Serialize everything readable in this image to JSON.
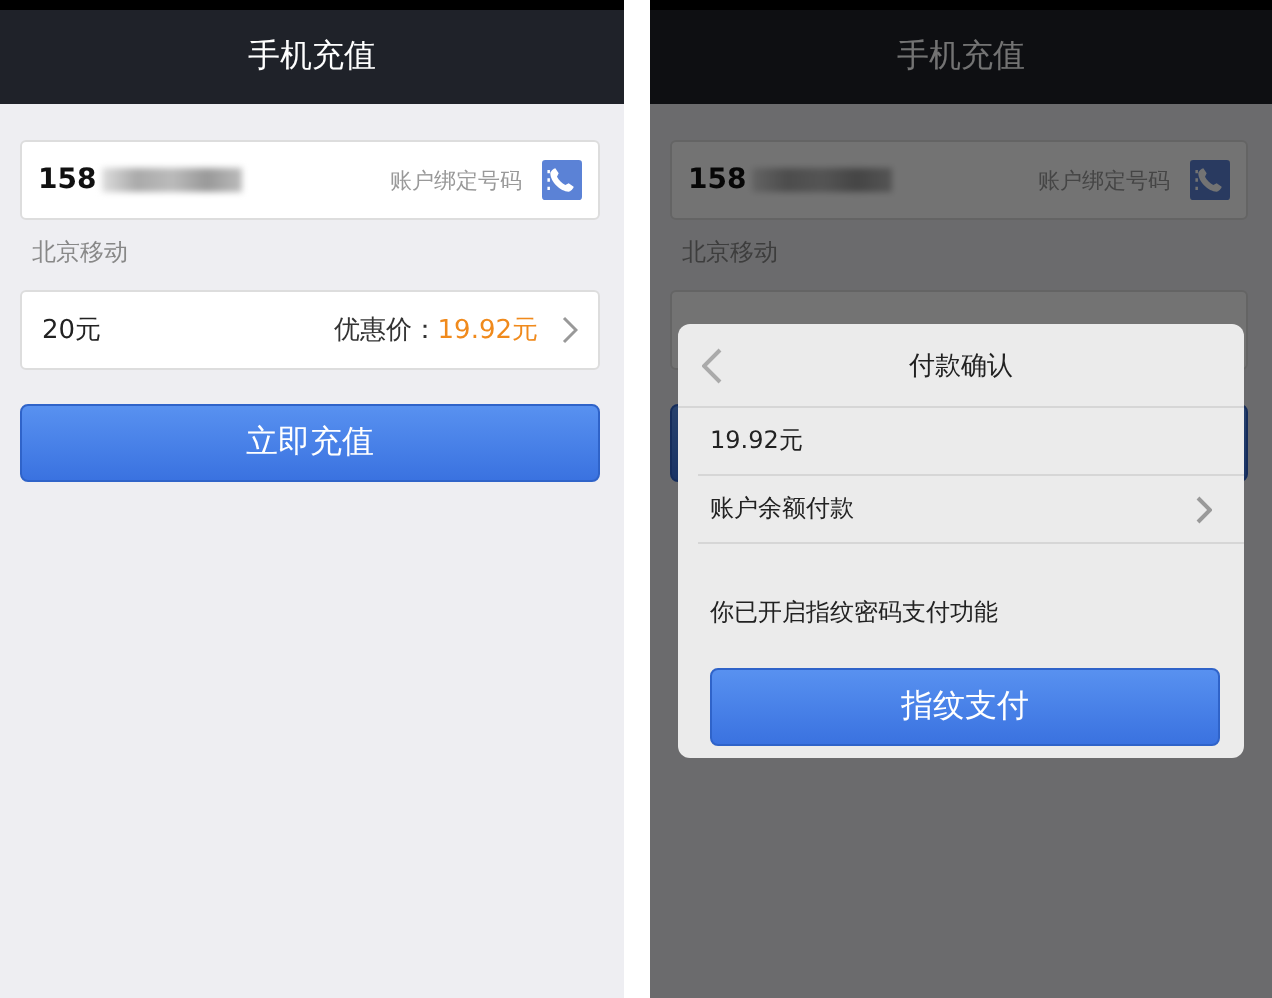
{
  "left": {
    "title": "手机充值",
    "phone_prefix": "158",
    "phone_hint": "账户绑定号码",
    "carrier": "北京移动",
    "amount": "20元",
    "price_label": "优惠价：",
    "price": "19.92元",
    "button": "立即充值"
  },
  "right": {
    "title": "手机充值",
    "phone_prefix": "158",
    "phone_hint": "账户绑定号码",
    "carrier": "北京移动",
    "dialog": {
      "title": "付款确认",
      "amount": "19.92元",
      "method": "账户余额付款",
      "notice": "你已开启指纹密码支付功能",
      "button": "指纹支付"
    }
  }
}
